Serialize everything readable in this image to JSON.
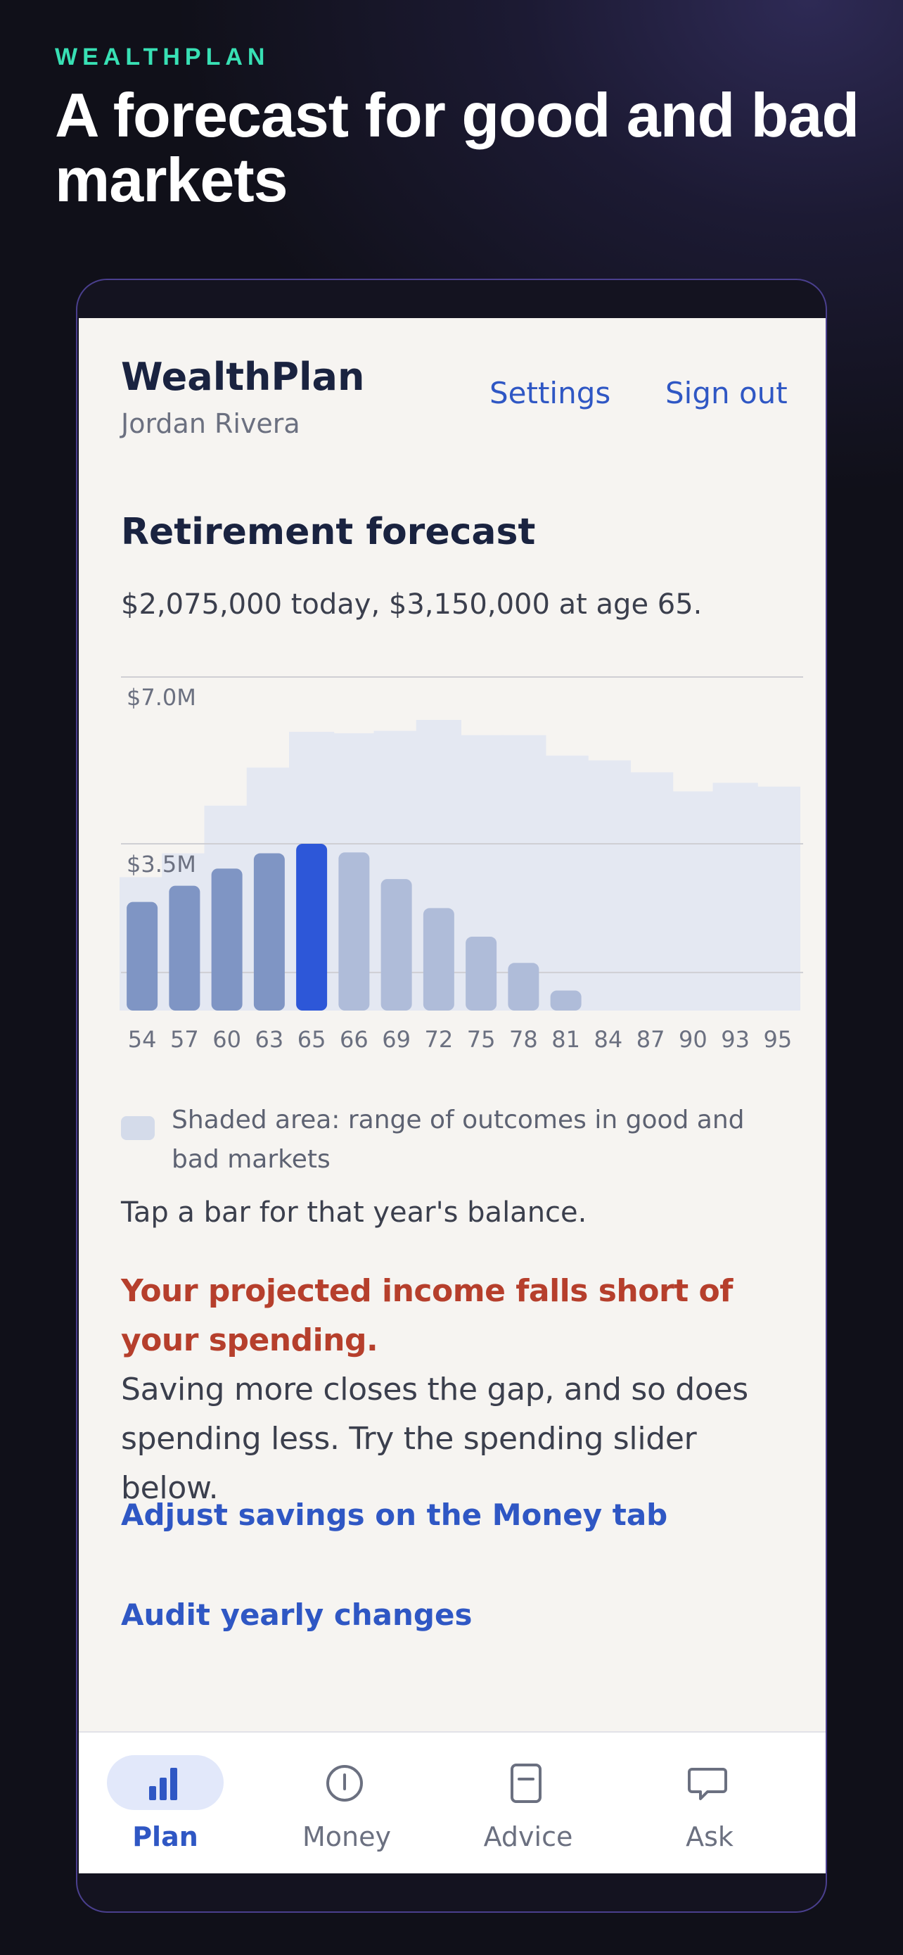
{
  "page": {
    "brand_tag": "WEALTHPLAN",
    "headline": "A forecast for good and bad markets"
  },
  "header": {
    "app_name": "WealthPlan",
    "user_name": "Jordan Rivera",
    "settings_label": "Settings",
    "signout_label": "Sign out"
  },
  "forecast": {
    "title": "Retirement forecast",
    "summary": "$2,075,000 today, $3,150,000 at age 65.",
    "legend_text": "Shaded area: range of outcomes in good and bad markets",
    "hint": "Tap a bar for that year's balance.",
    "warning_title": "Your projected income falls short of your spending.",
    "warning_body": "Saving more closes the gap, and so does spending less. Try the spending slider below.",
    "link_savings": "Adjust savings on the Money tab",
    "link_audit": "Audit yearly changes"
  },
  "chart_data": {
    "type": "bar",
    "categories": [
      "54",
      "57",
      "60",
      "63",
      "65",
      "66",
      "69",
      "72",
      "75",
      "78",
      "81",
      "84",
      "87",
      "90",
      "93",
      "95"
    ],
    "values": [
      2.28,
      2.62,
      2.98,
      3.3,
      3.5,
      3.32,
      2.76,
      2.15,
      1.55,
      1.0,
      0.42,
      0,
      0,
      0,
      0,
      0
    ],
    "band_high": [
      2.8,
      3.3,
      4.3,
      5.1,
      5.85,
      5.82,
      5.87,
      6.1,
      5.78,
      5.78,
      5.35,
      5.25,
      5.0,
      4.6,
      4.78,
      4.7
    ],
    "highlight_index": 4,
    "yticks": [
      {
        "value": 7.0,
        "label": "$7.0M"
      },
      {
        "value": 3.5,
        "label": "$3.5M"
      },
      {
        "value": 0.8,
        "label": ""
      }
    ],
    "ylim": [
      0,
      7.0
    ],
    "colors": {
      "pre_retirement": "#7f95c4",
      "highlight": "#2d57d8",
      "post_retirement": "#afbcd9",
      "band": "#e4e8f2"
    }
  },
  "tabs": [
    {
      "label": "Plan",
      "icon": "bar-chart-icon",
      "active": true
    },
    {
      "label": "Money",
      "icon": "info-circle-icon",
      "active": false
    },
    {
      "label": "Advice",
      "icon": "document-icon",
      "active": false
    },
    {
      "label": "Ask",
      "icon": "chat-bubble-icon",
      "active": false
    }
  ]
}
